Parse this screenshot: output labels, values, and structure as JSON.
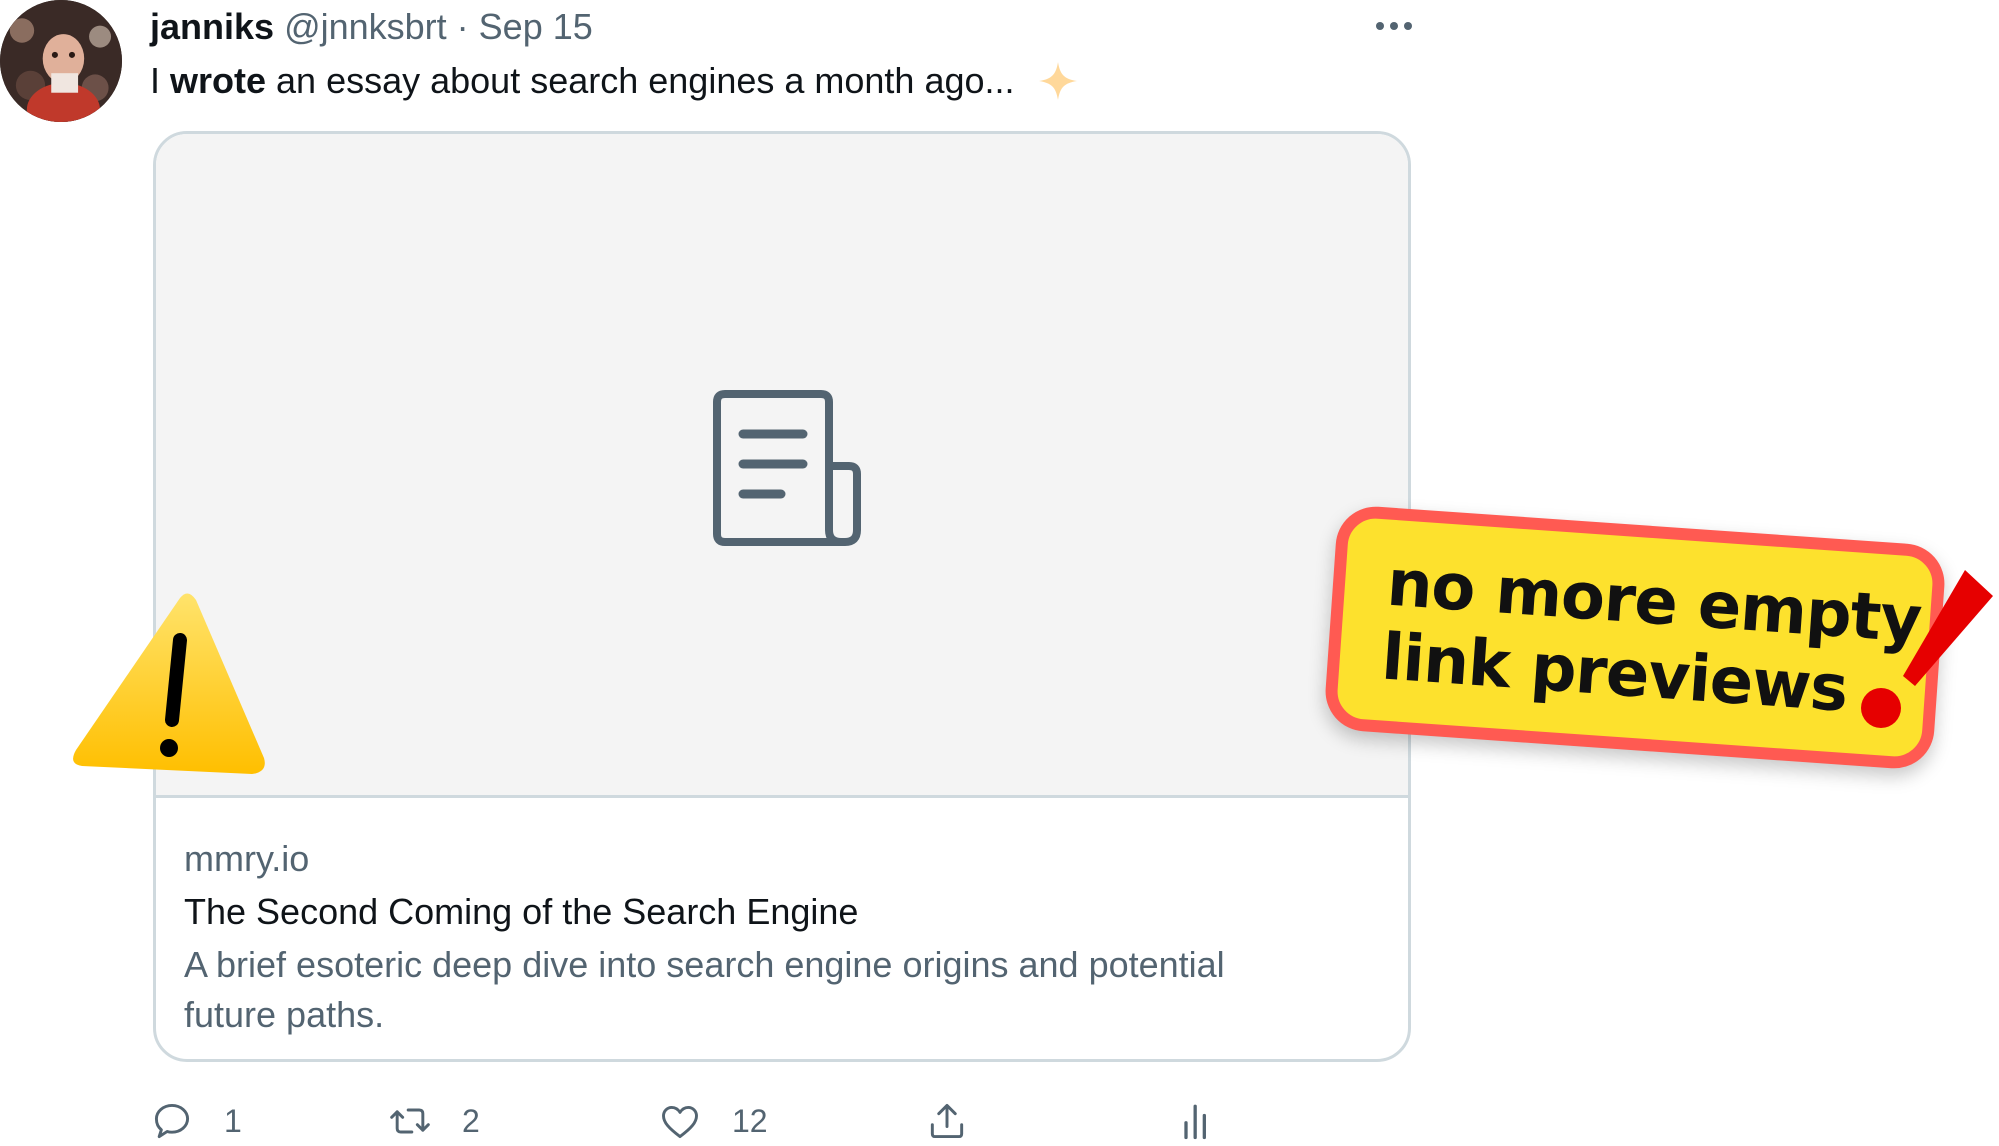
{
  "tweet": {
    "author_name": "janniks",
    "author_handle": "@jnnksbrt",
    "separator": "·",
    "date": "Sep 15",
    "text_before": "I",
    "text_bold": "wrote",
    "text_after": "an essay about search engines a month ago...",
    "avatar_alt": "avatar",
    "more_icon": "more-horizontal-icon",
    "sparkle_icon": "sparkle-icon"
  },
  "card": {
    "media_icon": "document-icon",
    "domain": "mmry.io",
    "title": "The Second Coming of the Search Engine",
    "description": "A brief esoteric deep dive into search engine origins and potential future paths."
  },
  "overlay": {
    "sticker_line1": "no more empty",
    "sticker_line2": "link previews",
    "warning_icon": "warning-icon",
    "exclamation_icon": "exclamation-icon",
    "colors": {
      "sticker_fill": "#fde12d",
      "sticker_border": "#ff5a52",
      "exclamation": "#e60000",
      "warning": "#ffc800"
    }
  },
  "actions": {
    "reply_count": "1",
    "retweet_count": "2",
    "like_count": "12",
    "reply_icon": "reply-icon",
    "retweet_icon": "retweet-icon",
    "like_icon": "heart-icon",
    "share_icon": "share-icon",
    "analytics_icon": "analytics-icon"
  }
}
